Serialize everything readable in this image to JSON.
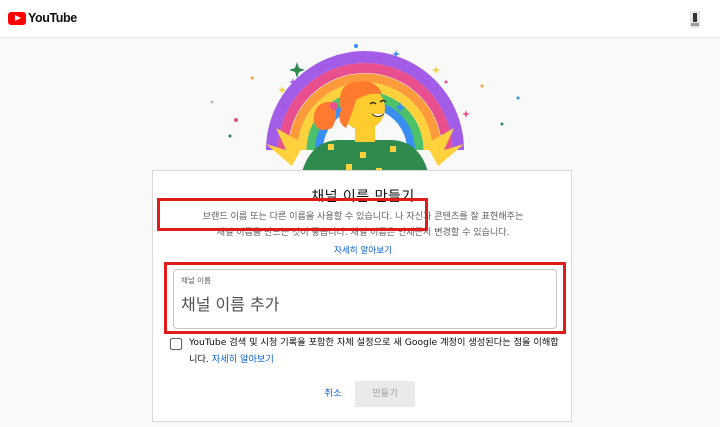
{
  "header": {
    "logo_text": "YouTube",
    "brand_color": "#ff0000"
  },
  "dialog": {
    "title": "채널 이름 만들기",
    "description_line1": "브랜드 이름 또는 다른 이름을 사용할 수 있습니다. 나 자신과 콘텐츠를 잘 표현해주는",
    "description_line2": "채널 이름을 만드는 것이 좋습니다. 채널 이름은 언제든지 변경할 수 있습니다.",
    "learn_more": "자세히 알아보기",
    "name_field": {
      "label": "채널 이름",
      "placeholder": "채널 이름 추가",
      "value": ""
    },
    "consent": {
      "text": "YouTube 검색 및 시청 기록을 포함한 자체 설정으로 새 Google 계정이 생성된다는 점을 이해합니다.",
      "link": "자세히 알아보기",
      "checked": false
    },
    "cancel_label": "취소",
    "create_label": "만들기"
  },
  "annotations": {
    "highlight_color": "#e01b1b"
  },
  "icons": [
    "youtube-logo-icon",
    "account-icon",
    "rainbow-illustration"
  ]
}
